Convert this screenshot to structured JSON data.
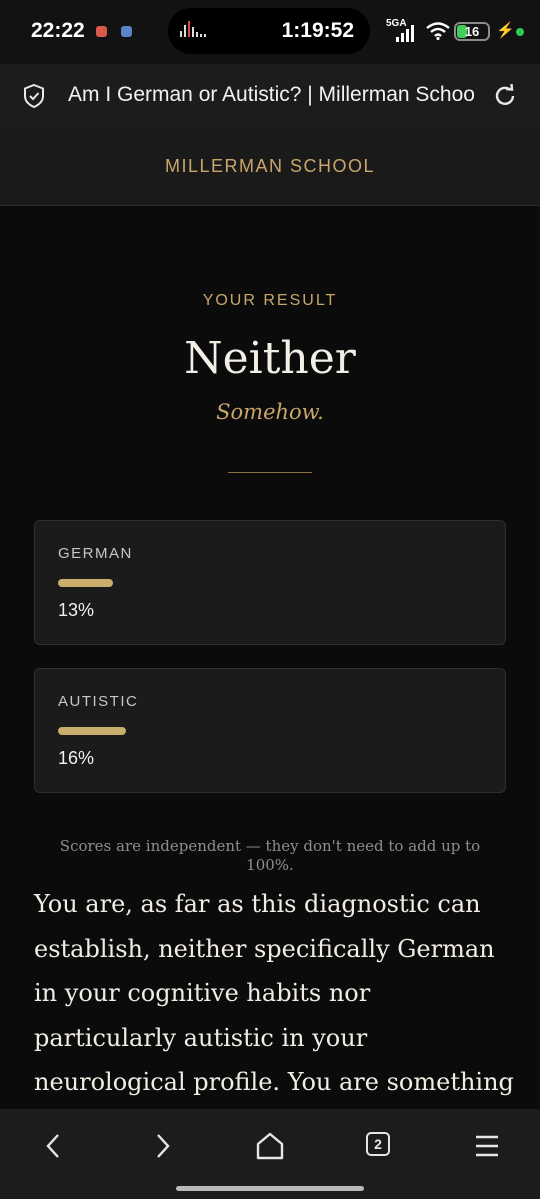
{
  "status_bar": {
    "time": "22:22",
    "call_timer": "1:19:52",
    "network": "5GA",
    "battery": "16",
    "icons": [
      "app-notification-icon",
      "app-notification-icon",
      "audio-wave-icon",
      "signal-icon",
      "wifi-icon",
      "battery-icon",
      "charging-bolt-icon",
      "privacy-dot-icon"
    ]
  },
  "browser": {
    "page_title": "Am I German or Autistic? | Millerman School",
    "tab_count": "2",
    "icons": [
      "shield-icon",
      "reload-icon",
      "back-icon",
      "forward-icon",
      "home-icon",
      "tabs-icon",
      "menu-icon"
    ]
  },
  "site": {
    "brand": "MILLERMAN SCHOOL"
  },
  "result": {
    "eyebrow": "YOUR RESULT",
    "verdict": "Neither",
    "tagline": "Somehow."
  },
  "scores": [
    {
      "label": "GERMAN",
      "value_text": "13%",
      "value": 13
    },
    {
      "label": "AUTISTIC",
      "value_text": "16%",
      "value": 16
    }
  ],
  "note": "Scores are independent — they don't need to add up to 100%.",
  "body_text": "You are, as far as this diagnostic can establish, neither specifically German in your cognitive habits nor particularly autistic in your neurological profile. You are something",
  "colors": {
    "accent": "#c9a66b",
    "bar": "#c9ae6e",
    "background": "#0b0b0b",
    "card": "#1b1b1b"
  }
}
